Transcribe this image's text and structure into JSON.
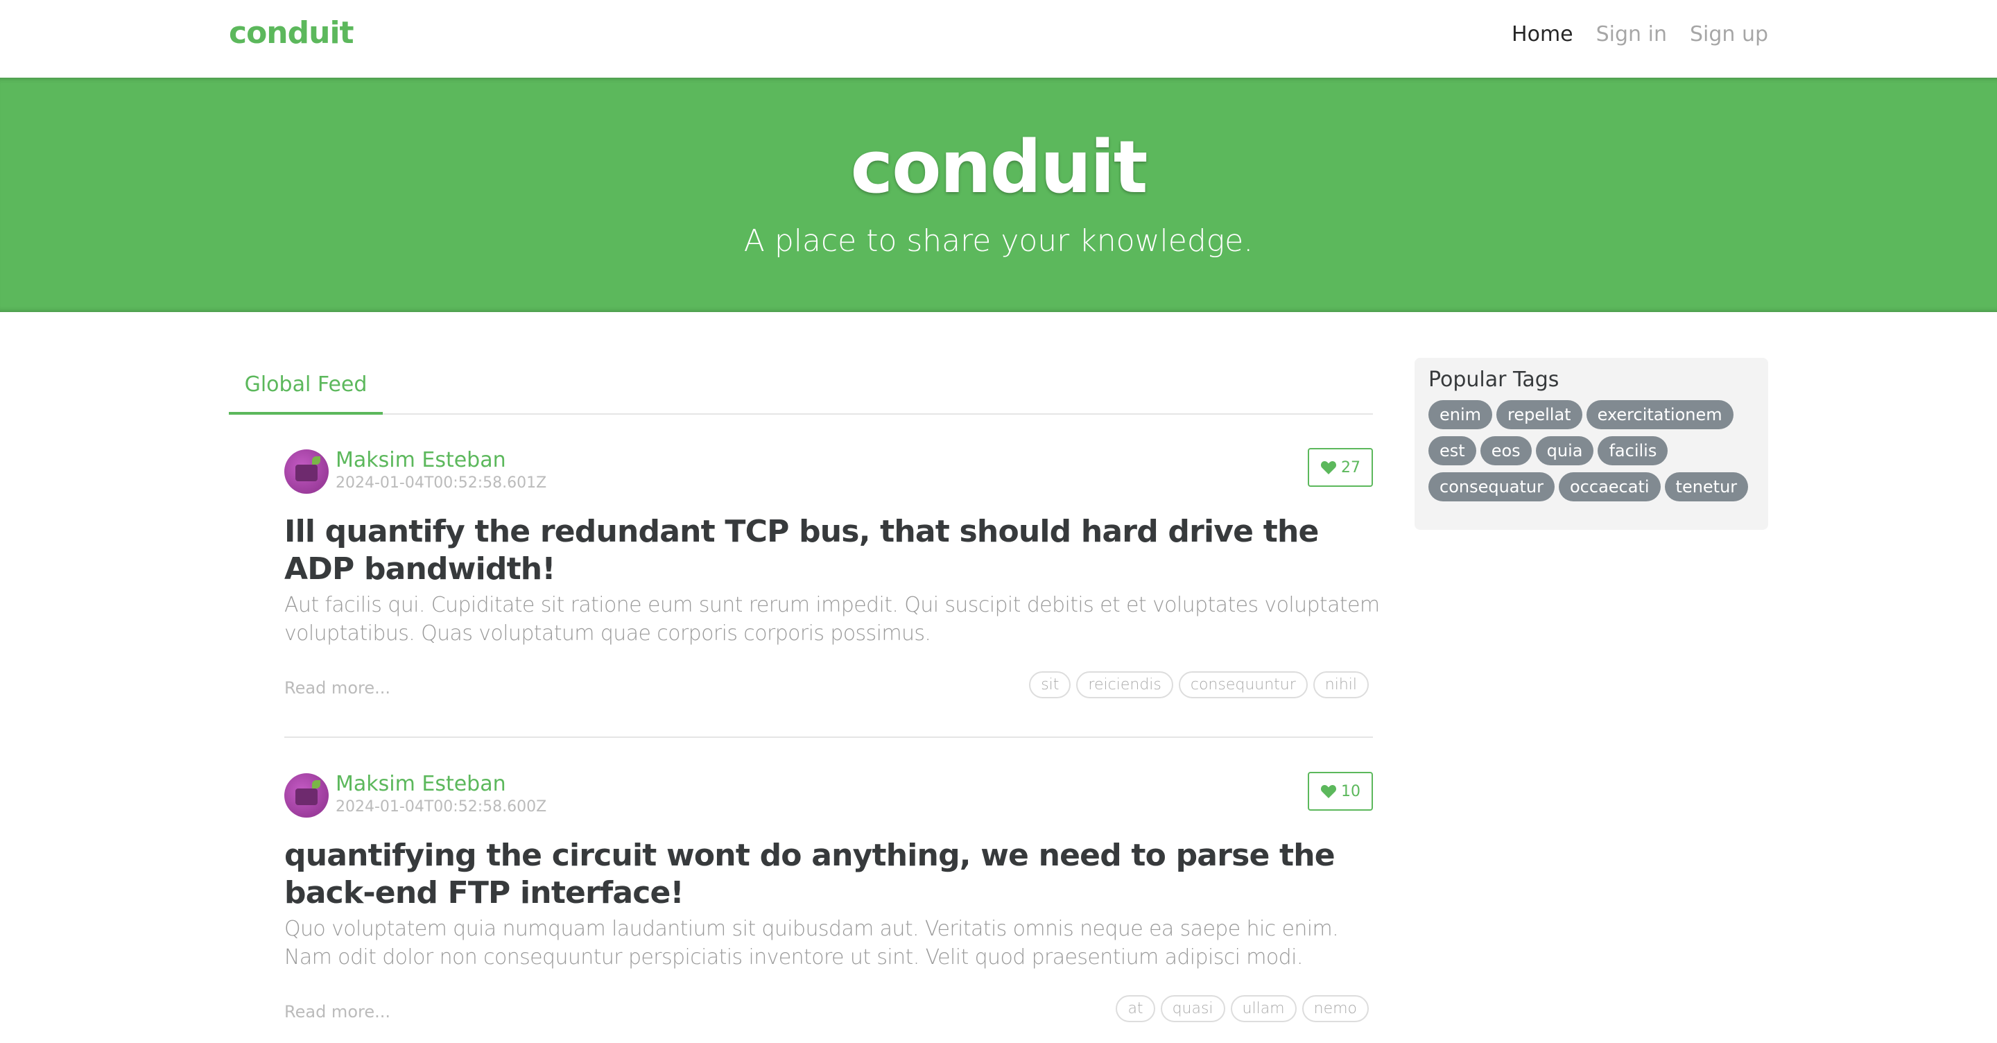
{
  "nav": {
    "brand": "conduit",
    "links": [
      "Home",
      "Sign in",
      "Sign up"
    ]
  },
  "banner": {
    "title": "conduit",
    "subtitle": "A place to share your knowledge."
  },
  "feed": {
    "tab": "Global Feed",
    "read_more": "Read more..."
  },
  "articles": [
    {
      "author": "Maksim Esteban",
      "date": "2024-01-04T00:52:58.601Z",
      "likes": "27",
      "title": "Ill quantify the redundant TCP bus, that should hard drive the ADP bandwidth!",
      "description": "Aut facilis qui. Cupiditate sit ratione eum sunt rerum impedit. Qui suscipit debitis et et voluptates voluptatem voluptatibus. Quas voluptatum quae corporis corporis possimus.",
      "tags": [
        "sit",
        "reiciendis",
        "consequuntur",
        "nihil"
      ]
    },
    {
      "author": "Maksim Esteban",
      "date": "2024-01-04T00:52:58.600Z",
      "likes": "10",
      "title": "quantifying the circuit wont do anything, we need to parse the back-end FTP interface!",
      "description": "Quo voluptatem quia numquam laudantium sit quibusdam aut. Veritatis omnis neque ea saepe hic enim. Nam odit dolor non consequuntur perspiciatis inventore ut sint. Velit quod praesentium adipisci modi.",
      "tags": [
        "at",
        "quasi",
        "ullam",
        "nemo"
      ]
    }
  ],
  "sidebar": {
    "title": "Popular Tags",
    "tags": [
      "enim",
      "repellat",
      "exercitationem",
      "est",
      "eos",
      "quia",
      "facilis",
      "consequatur",
      "occaecati",
      "tenetur"
    ]
  },
  "colors": {
    "brand": "#5cb85c",
    "tag_pill": "#818a91"
  },
  "icons": {
    "like": "heart-icon",
    "avatar": "avatar-image"
  }
}
